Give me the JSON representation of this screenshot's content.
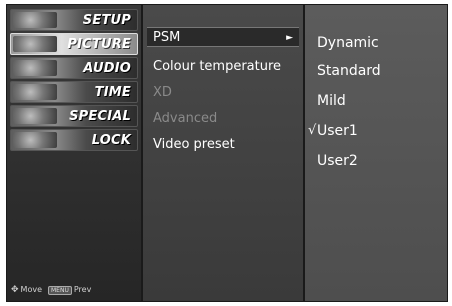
{
  "main_menu": {
    "tabs": [
      {
        "label": "SETUP",
        "icon": "setup-icon",
        "active": false
      },
      {
        "label": "PICTURE",
        "icon": "picture-icon",
        "active": true
      },
      {
        "label": "AUDIO",
        "icon": "audio-icon",
        "active": false
      },
      {
        "label": "TIME",
        "icon": "time-icon",
        "active": false
      },
      {
        "label": "SPECIAL",
        "icon": "special-icon",
        "active": false
      },
      {
        "label": "LOCK",
        "icon": "lock-icon",
        "active": false
      }
    ],
    "help": {
      "move_label": "Move",
      "prev_key": "MENU",
      "prev_label": "Prev"
    }
  },
  "submenu": {
    "items": [
      {
        "label": "PSM",
        "state": "selected",
        "arrow": "►"
      },
      {
        "label": "Colour temperature",
        "state": "enabled"
      },
      {
        "label": "XD",
        "state": "disabled"
      },
      {
        "label": "Advanced",
        "state": "disabled"
      },
      {
        "label": "Video preset",
        "state": "enabled"
      }
    ]
  },
  "psm_options": {
    "items": [
      {
        "label": "Dynamic",
        "checked": false
      },
      {
        "label": "Standard",
        "checked": false
      },
      {
        "label": "Mild",
        "checked": false
      },
      {
        "label": "User1",
        "checked": true
      },
      {
        "label": "User2",
        "checked": false
      }
    ],
    "check_mark": "√"
  }
}
